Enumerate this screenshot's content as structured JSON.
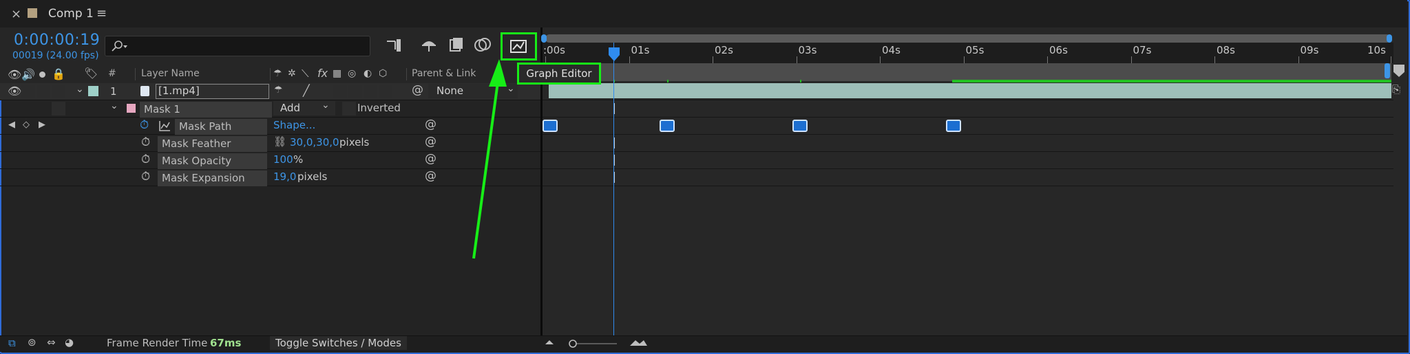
{
  "tab": {
    "title": "Comp 1",
    "close": "×",
    "menu": "≡"
  },
  "header": {
    "timecode": "0:00:00:19",
    "fps_info": "00019 (24.00 fps)",
    "search_placeholder": ""
  },
  "columns": {
    "hash": "#",
    "layer_name": "Layer Name",
    "parent_link": "Parent & Link",
    "fx": "fx"
  },
  "layer": {
    "number": "1",
    "name": "[1.mp4]",
    "parent": "None",
    "label_color": "#9ed0c8"
  },
  "mask": {
    "name": "Mask 1",
    "mode": "Add",
    "inverted_label": "Inverted",
    "label_color": "#e6a7c0"
  },
  "properties": [
    {
      "name": "Mask Path",
      "value": "Shape...",
      "unit": ""
    },
    {
      "name": "Mask Feather",
      "value": "30,0,30,0",
      "unit": "pixels"
    },
    {
      "name": "Mask Opacity",
      "value": "100",
      "unit": "%"
    },
    {
      "name": "Mask Expansion",
      "value": "19,0",
      "unit": "pixels"
    }
  ],
  "timeline": {
    "ticks": [
      ":00s",
      "01s",
      "02s",
      "03s",
      "04s",
      "05s",
      "06s",
      "07s",
      "08s",
      "09s",
      "10s"
    ],
    "current_time_s": 0.79
  },
  "tooltip": "Graph Editor",
  "footer": {
    "frame_render_label": "Frame Render Time",
    "frame_render_value": "67ms",
    "toggle_label": "Toggle Switches / Modes"
  },
  "colors": {
    "accent_blue": "#3d95e6",
    "annotation_green": "#17ee17"
  }
}
